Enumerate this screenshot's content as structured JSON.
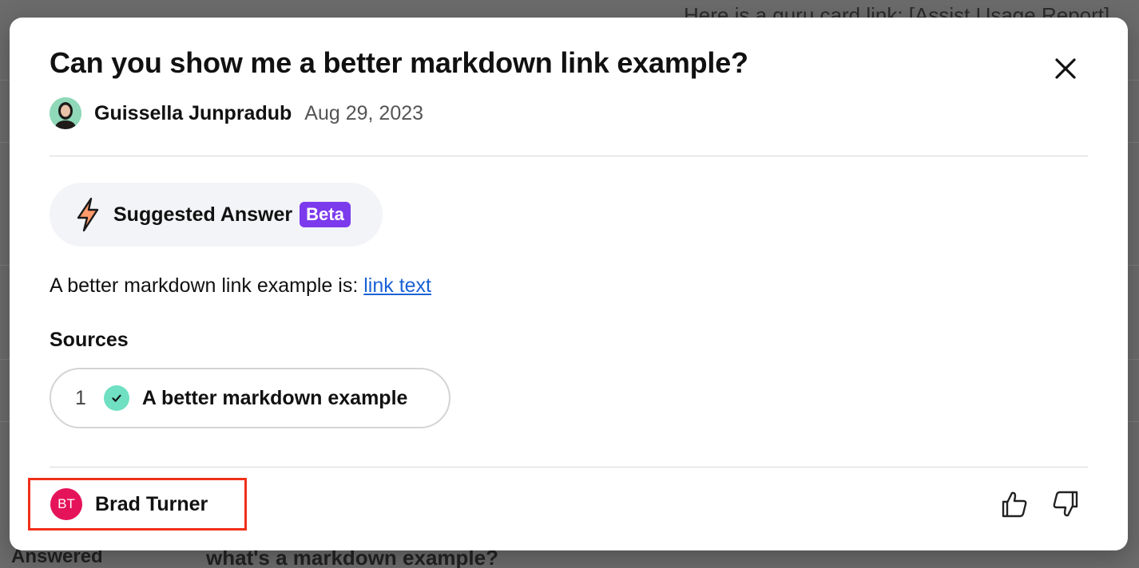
{
  "background": {
    "top_text": "Here is a guru card link: [Assist Usage Report]",
    "status_label": "Answered",
    "question_text": "what's a markdown example?"
  },
  "modal": {
    "title": "Can you show me a better markdown link example?",
    "author": {
      "name": "Guissella Junpradub",
      "date": "Aug 29, 2023",
      "avatar_icon": "user-photo"
    },
    "suggested_answer": {
      "label": "Suggested Answer",
      "badge": "Beta",
      "icon": "lightning-bolt-icon"
    },
    "answer": {
      "prefix": "A better markdown link example is: ",
      "link_text": "link text"
    },
    "sources": {
      "heading": "Sources",
      "items": [
        {
          "number": "1",
          "title": "A better markdown example",
          "verified_icon": "check-icon"
        }
      ]
    },
    "answerer": {
      "initials": "BT",
      "name": "Brad Turner"
    },
    "actions": {
      "thumbs_up_icon": "thumbs-up-icon",
      "thumbs_down_icon": "thumbs-down-icon",
      "close_icon": "close-icon"
    },
    "colors": {
      "accent_link": "#1a62d6",
      "beta_badge": "#7c3aed",
      "answerer_avatar": "#e5135a",
      "verified_check": "#6fe0c2",
      "highlight_border": "#f0301a"
    }
  }
}
